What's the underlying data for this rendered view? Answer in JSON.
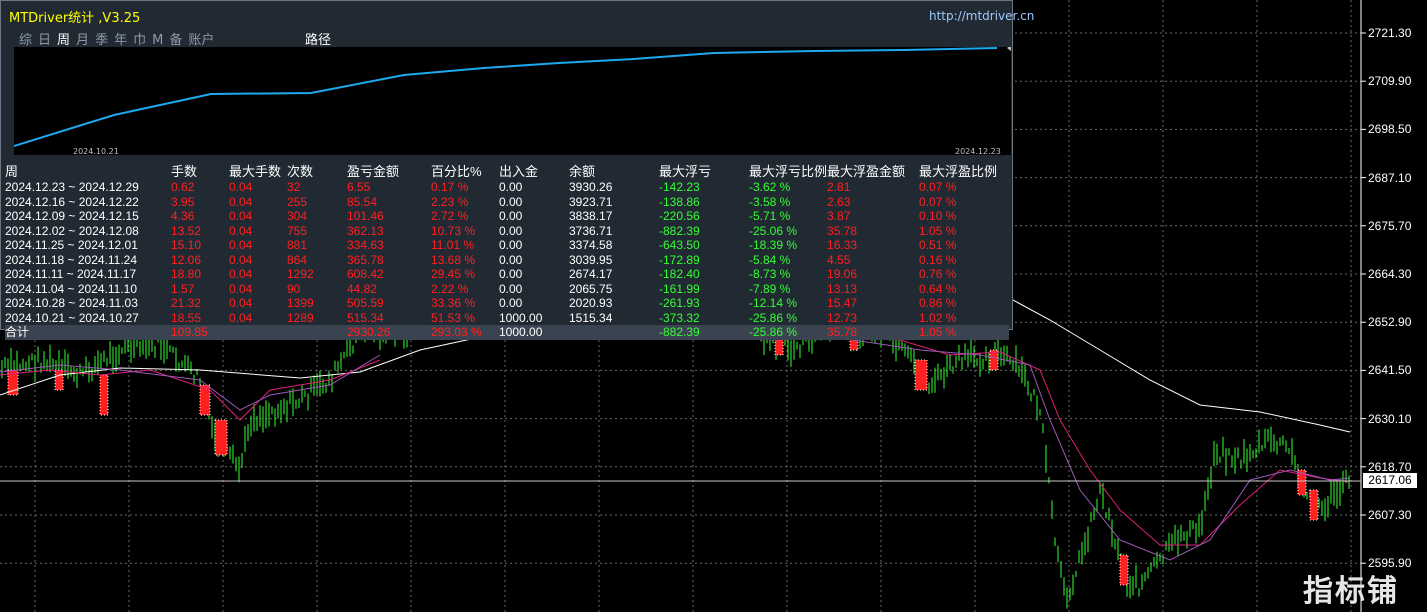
{
  "app": {
    "title": "MTDriver统计 ,V3.25",
    "url": "http://mtdriver.cn"
  },
  "tabs": [
    "综",
    "日",
    "周",
    "月",
    "季",
    "年",
    "巾",
    "M",
    "备",
    "账户"
  ],
  "active_tab": "周",
  "route_label": "路径",
  "equity_dates": {
    "start": "2024.10.21",
    "end": "2024.12.23"
  },
  "table": {
    "headers": [
      "周",
      "手数",
      "最大手数",
      "次数",
      "盈亏金额",
      "百分比%",
      "出入金",
      "余额",
      "最大浮亏",
      "最大浮亏比例",
      "最大浮盈金额",
      "最大浮盈比例"
    ],
    "rows": [
      [
        "2024.12.23 ~ 2024.12.29",
        "0.62",
        "0.04",
        "32",
        "6.55",
        "0.17 %",
        "0.00",
        "3930.26",
        "-142.23",
        "-3.62 %",
        "2.81",
        "0.07 %"
      ],
      [
        "2024.12.16 ~ 2024.12.22",
        "3.95",
        "0.04",
        "255",
        "85.54",
        "2.23 %",
        "0.00",
        "3923.71",
        "-138.86",
        "-3.58 %",
        "2.63",
        "0.07 %"
      ],
      [
        "2024.12.09 ~ 2024.12.15",
        "4.36",
        "0.04",
        "304",
        "101.46",
        "2.72 %",
        "0.00",
        "3838.17",
        "-220.56",
        "-5.71 %",
        "3.87",
        "0.10 %"
      ],
      [
        "2024.12.02 ~ 2024.12.08",
        "13.52",
        "0.04",
        "755",
        "362.13",
        "10.73 %",
        "0.00",
        "3736.71",
        "-882.39",
        "-25.06 %",
        "35.78",
        "1.05 %"
      ],
      [
        "2024.11.25 ~ 2024.12.01",
        "15.10",
        "0.04",
        "881",
        "334.63",
        "11.01 %",
        "0.00",
        "3374.58",
        "-643.50",
        "-18.39 %",
        "16.33",
        "0.51 %"
      ],
      [
        "2024.11.18 ~ 2024.11.24",
        "12.06",
        "0.04",
        "864",
        "365.78",
        "13.68 %",
        "0.00",
        "3039.95",
        "-172.89",
        "-5.84 %",
        "4.55",
        "0.16 %"
      ],
      [
        "2024.11.11 ~ 2024.11.17",
        "18.80",
        "0.04",
        "1292",
        "608.42",
        "29.45 %",
        "0.00",
        "2674.17",
        "-182.40",
        "-8.73 %",
        "19.06",
        "0.76 %"
      ],
      [
        "2024.11.04 ~ 2024.11.10",
        "1.57",
        "0.04",
        "90",
        "44.82",
        "2.22 %",
        "0.00",
        "2065.75",
        "-161.99",
        "-7.89 %",
        "13.13",
        "0.64 %"
      ],
      [
        "2024.10.28 ~ 2024.11.03",
        "21.32",
        "0.04",
        "1399",
        "505.59",
        "33.36 %",
        "0.00",
        "2020.93",
        "-261.93",
        "-12.14 %",
        "15.47",
        "0.86 %"
      ],
      [
        "2024.10.21 ~ 2024.10.27",
        "18.55",
        "0.04",
        "1289",
        "515.34",
        "51.53 %",
        "1000.00",
        "1515.34",
        "-373.32",
        "-25.86 %",
        "12.73",
        "1.02 %"
      ]
    ],
    "total": [
      "合计",
      "109.85",
      "",
      "",
      "2930.26",
      "293.03 %",
      "1000.00",
      "",
      "-882.39",
      "-25.86 %",
      "35.78",
      "1.05 %"
    ]
  },
  "price_axis": [
    "2721.30",
    "2709.90",
    "2698.50",
    "2687.10",
    "2675.70",
    "2664.30",
    "2652.90",
    "2641.50",
    "2630.10",
    "2618.70",
    "2607.30",
    "2595.90"
  ],
  "current_price": "2617.06",
  "watermark": "指标铺",
  "colors": {
    "panel_bg": "#212a33",
    "equity_line": "#1ea9ee",
    "candle_bull": "#33ff33",
    "ma_white": "#ffffff",
    "ma_pink": "#e0207a",
    "ma_purple": "#9b59b6",
    "profit_red": "#ff2020",
    "loss_green": "#33ff33"
  }
}
